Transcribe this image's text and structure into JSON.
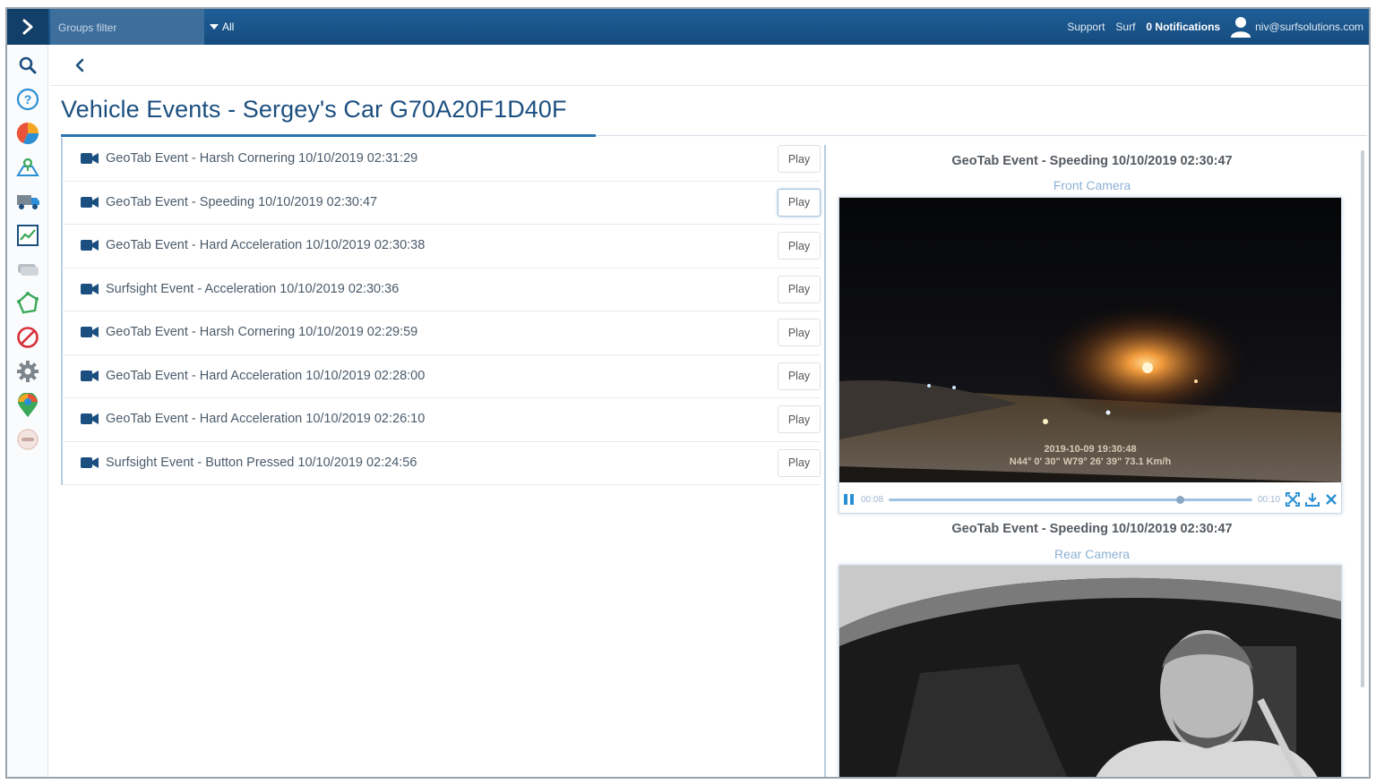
{
  "topbar": {
    "groups_filter_label": "Groups filter",
    "groups_filter_value": "All",
    "support_label": "Support",
    "surf_label": "Surf",
    "notifications_label": "0 Notifications",
    "user_email": "niv@surfsolutions.com"
  },
  "sidebar": {
    "icons": [
      "search-icon",
      "help-icon",
      "pie-chart-icon",
      "map-icon",
      "truck-icon",
      "line-chart-icon",
      "vehicles-icon",
      "geofence-icon",
      "block-icon",
      "settings-icon",
      "location-pin-icon",
      "badge-icon"
    ]
  },
  "page": {
    "title": "Vehicle Events - Sergey's Car G70A20F1D40F"
  },
  "events": [
    {
      "label": "GeoTab Event - Harsh Cornering 10/10/2019 02:31:29",
      "play": "Play"
    },
    {
      "label": "GeoTab Event - Speeding 10/10/2019 02:30:47",
      "play": "Play"
    },
    {
      "label": "GeoTab Event - Hard Acceleration 10/10/2019 02:30:38",
      "play": "Play"
    },
    {
      "label": "Surfsight Event - Acceleration 10/10/2019 02:30:36",
      "play": "Play"
    },
    {
      "label": "GeoTab Event - Harsh Cornering 10/10/2019 02:29:59",
      "play": "Play"
    },
    {
      "label": "GeoTab Event - Hard Acceleration 10/10/2019 02:28:00",
      "play": "Play"
    },
    {
      "label": "GeoTab Event - Hard Acceleration 10/10/2019 02:26:10",
      "play": "Play"
    },
    {
      "label": "Surfsight Event - Button Pressed 10/10/2019 02:24:56",
      "play": "Play"
    }
  ],
  "front_video": {
    "title": "GeoTab Event - Speeding 10/10/2019 02:30:47",
    "camera": "Front Camera",
    "overlay_line1": "2019-10-09 19:30:48",
    "overlay_line2": "N44° 0' 30\" W79° 26' 39\" 73.1 Km/h",
    "time_current": "00:08",
    "time_total": "00:10",
    "progress": 0.8
  },
  "rear_video": {
    "title": "GeoTab Event - Speeding 10/10/2019 02:30:47",
    "camera": "Rear Camera"
  },
  "colors": {
    "topbar": "#1e5e97",
    "title": "#1c4f80",
    "accent": "#2a72b0"
  }
}
